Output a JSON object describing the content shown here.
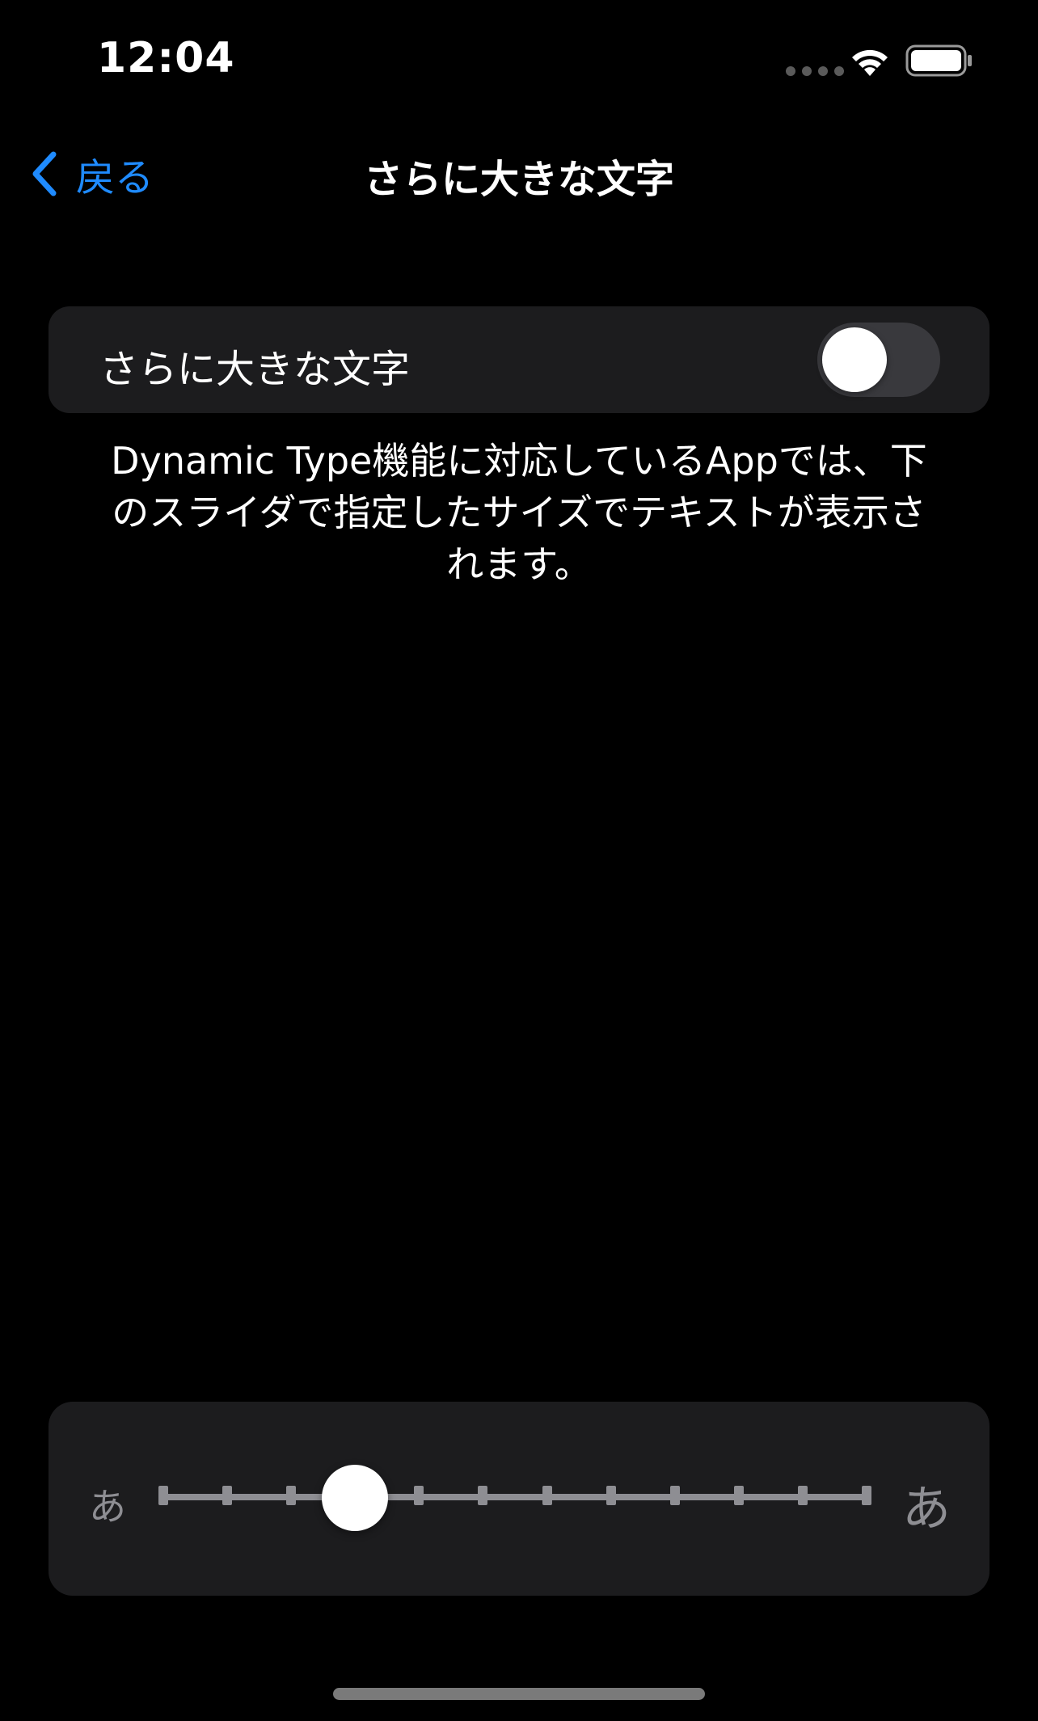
{
  "status_bar": {
    "time": "12:04",
    "wifi_icon": "wifi-icon",
    "battery_icon": "battery-icon",
    "signal_icon": "signal-dots-icon"
  },
  "nav": {
    "back_label": "戻る",
    "back_icon": "chevron-left-icon",
    "title": "さらに大きな文字"
  },
  "toggle": {
    "label": "さらに大きな文字",
    "state": "off"
  },
  "description": "Dynamic Type機能に対応しているAppでは、下のスライダで指定したサイズでテキストが表示されます。",
  "slider": {
    "small_label": "あ",
    "large_label": "あ",
    "steps": 12,
    "selected_index": 3
  },
  "colors": {
    "accent": "#1f8bff",
    "background": "#000000",
    "card": "#1c1c1e",
    "secondary_text": "#8e8e93"
  }
}
